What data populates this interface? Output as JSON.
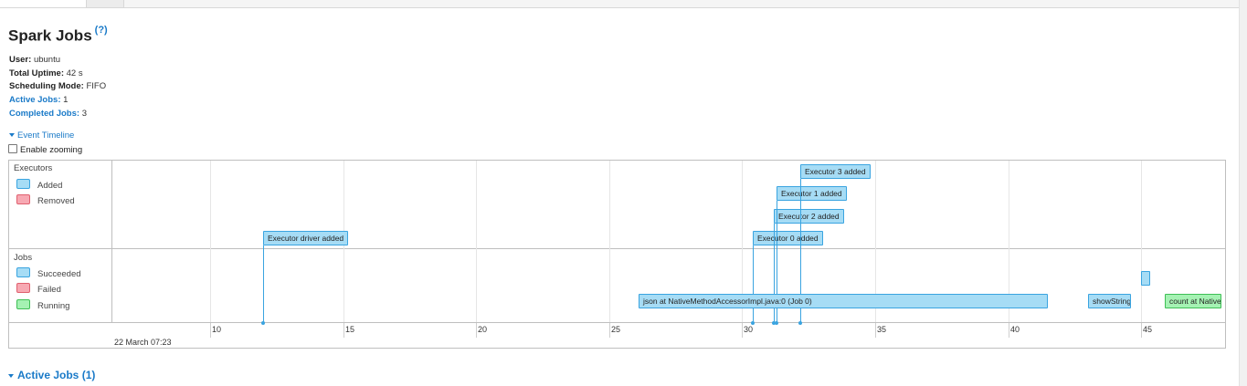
{
  "page": {
    "title": "Spark Jobs",
    "help": "(?)"
  },
  "summary": {
    "user_label": "User:",
    "user_value": "ubuntu",
    "uptime_label": "Total Uptime:",
    "uptime_value": "42 s",
    "scheduling_label": "Scheduling Mode:",
    "scheduling_value": "FIFO",
    "active_label": "Active Jobs:",
    "active_value": "1",
    "completed_label": "Completed Jobs:",
    "completed_value": "3"
  },
  "timeline": {
    "toggle_label": "Event Timeline",
    "zoom_label": "Enable zooming",
    "date_label": "22 March 07:23",
    "executors_group": {
      "label": "Executors",
      "legend": [
        {
          "label": "Added",
          "color": "#a6dcf5"
        },
        {
          "label": "Removed",
          "color": "#f7a9b3"
        }
      ]
    },
    "jobs_group": {
      "label": "Jobs",
      "legend": [
        {
          "label": "Succeeded",
          "color": "#a6dcf5"
        },
        {
          "label": "Failed",
          "color": "#f7a9b3"
        },
        {
          "label": "Running",
          "color": "#a5f2b3"
        }
      ]
    },
    "ticks": [
      "10",
      "15",
      "20",
      "25",
      "30",
      "35",
      "40",
      "45"
    ],
    "executor_events": [
      {
        "label": "Executor driver added",
        "time": 12.0
      },
      {
        "label": "Executor 0 added",
        "time": 30.4
      },
      {
        "label": "Executor 2 added",
        "time": 31.2
      },
      {
        "label": "Executor 1 added",
        "time": 31.3
      },
      {
        "label": "Executor 3 added",
        "time": 32.2
      }
    ],
    "jobs": [
      {
        "label": "json at NativeMethodAccessorImpl.java:0 (Job 0)",
        "start": 26.1,
        "end": 41.5,
        "status": "succeeded"
      },
      {
        "label": "showString",
        "start": 43.0,
        "end": 44.6,
        "status": "succeeded"
      },
      {
        "label": "",
        "start": 45.0,
        "end": 45.2,
        "status": "succeeded"
      },
      {
        "label": "count at Native",
        "start": 45.9,
        "end": 48.0,
        "status": "running"
      }
    ]
  },
  "active_jobs_header": "Active Jobs (1)"
}
